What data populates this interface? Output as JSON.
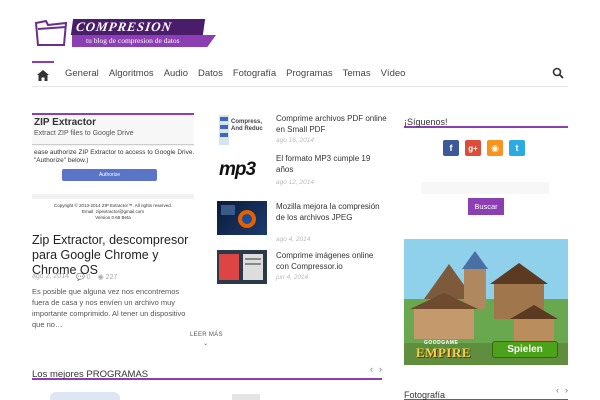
{
  "site": {
    "logo_title": "COMPRESION",
    "tagline": "tu blog de compresion de datos",
    "colors": {
      "accent": "#8c3fb3",
      "dark": "#4a1d6b"
    }
  },
  "nav": {
    "home_icon": "home-icon",
    "items": [
      "General",
      "Algoritmos",
      "Audio",
      "Datos",
      "Fotografía",
      "Programas",
      "Temas",
      "Vídeo"
    ],
    "search_icon": "search-icon"
  },
  "featured": {
    "screenshot": {
      "title": "ZIP Extractor",
      "subtitle": "Extract ZIP files to Google Drive",
      "auth_text": "ease authorize ZIP Extractor to access to Google Drive. (Cli\n\"Authorize\" below.)",
      "button_label": "Authorize",
      "footer_text": "Copyright © 2013-2014 ZIP Extractor™. All rights reserved.\nEmail: zipextractor@gmail.com\nVersion 0.68 Beta"
    },
    "title": "Zip Extractor, descompresor para Google Chrome y Chrome OS",
    "date": "ago 2, 2014",
    "comments": "0",
    "views": "227",
    "excerpt": "Es posible que alguna vez nos encontremos fuera de casa y nos envíen un archivo muy importante comprimido. Al tener un dispositivo que no…",
    "read_more": "LEER MÁS"
  },
  "posts": [
    {
      "title": "Comprime archivos PDF online en Small PDF",
      "date": "ago 16, 2014",
      "thumb_text": "Compress, And Reduc"
    },
    {
      "title": "El formato MP3 cumple 19 años",
      "date": "ago 12, 2014",
      "thumb_text": "mp3"
    },
    {
      "title": "Mozilla mejora la compresión de los archivos JPEG",
      "date": "ago 4, 2014",
      "thumb_text": ""
    },
    {
      "title": "Comprime imágenes online con Compressor.io",
      "date": "jun 4, 2014",
      "thumb_text": ""
    }
  ],
  "programs_section": {
    "title": "Los mejores PROGRAMAS",
    "prev": "‹",
    "next": "›"
  },
  "sidebar": {
    "follow_title": "¡Síguenos!",
    "social": [
      {
        "name": "facebook-icon",
        "glyph": "f",
        "color": "#3b5998"
      },
      {
        "name": "google-plus-icon",
        "glyph": "g+",
        "color": "#dd4b39"
      },
      {
        "name": "rss-icon",
        "glyph": "◉",
        "color": "#f7931e"
      },
      {
        "name": "twitter-icon",
        "glyph": "t",
        "color": "#2ba9e1"
      }
    ],
    "search_placeholder": "",
    "search_button": "Buscar",
    "ad": {
      "brand_small": "GOODGAME",
      "brand": "EMPIRE",
      "cta": "Spielen"
    },
    "photo_title": "Fotografía",
    "photo_prev": "‹",
    "photo_next": "›"
  }
}
